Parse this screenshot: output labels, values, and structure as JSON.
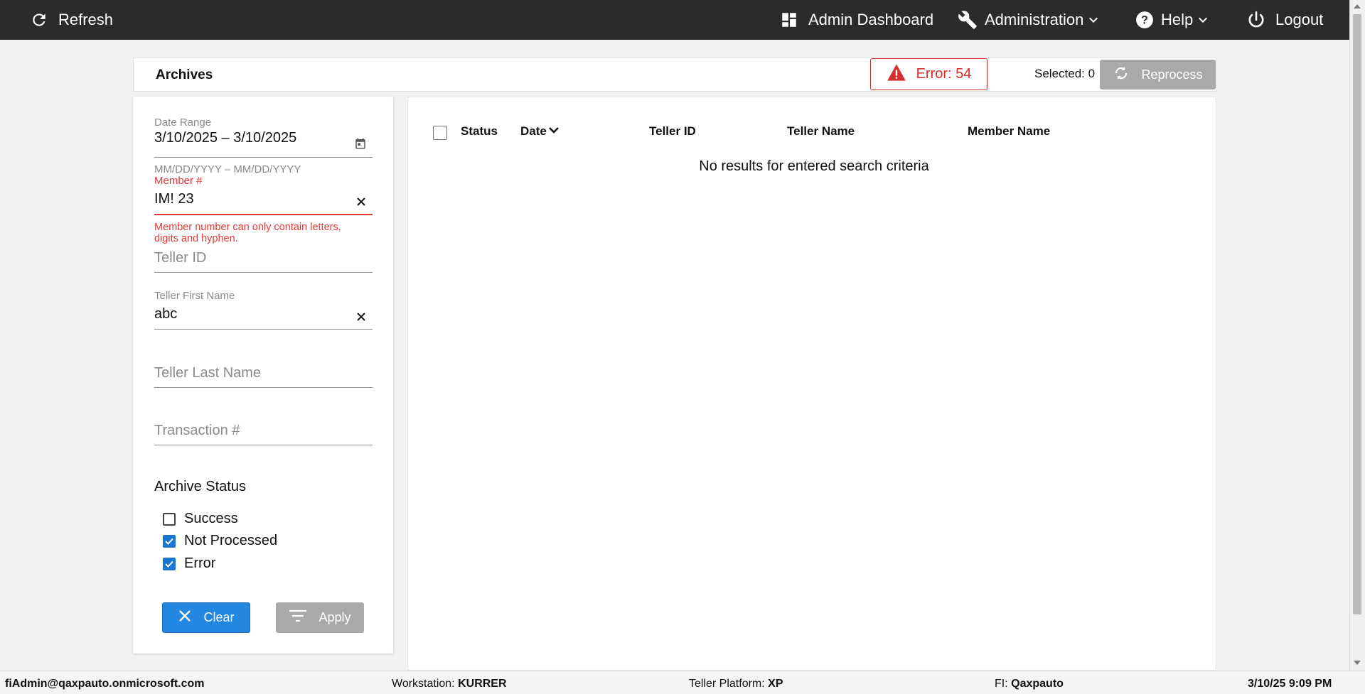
{
  "topbar": {
    "refresh_label": "Refresh",
    "admin_dashboard_label": "Admin Dashboard",
    "administration_label": "Administration",
    "help_label": "Help",
    "logout_label": "Logout"
  },
  "header": {
    "title": "Archives",
    "error_badge": "Error: 54",
    "selected_label": "Selected: 0",
    "reprocess_label": "Reprocess"
  },
  "filters": {
    "date_range": {
      "label": "Date Range",
      "value": "3/10/2025 – 3/10/2025",
      "hint": "MM/DD/YYYY – MM/DD/YYYY"
    },
    "member": {
      "label": "Member #",
      "value": "IM! 23",
      "error": "Member number can only contain letters, digits and hyphen."
    },
    "teller_id": {
      "placeholder": "Teller ID"
    },
    "teller_first_name": {
      "label": "Teller First Name",
      "value": "abc"
    },
    "teller_last_name": {
      "placeholder": "Teller Last Name"
    },
    "transaction": {
      "placeholder": "Transaction #"
    },
    "archive_status": {
      "title": "Archive Status",
      "options": [
        {
          "label": "Success",
          "checked": false
        },
        {
          "label": "Not Processed",
          "checked": true
        },
        {
          "label": "Error",
          "checked": true
        }
      ]
    },
    "clear_label": "Clear",
    "apply_label": "Apply"
  },
  "results": {
    "columns": [
      "Status",
      "Date",
      "Teller ID",
      "Teller Name",
      "Member Name"
    ],
    "empty_message": "No results for entered search criteria"
  },
  "footer": {
    "user": "fiAdmin@qaxpauto.onmicrosoft.com",
    "workstation_label": "Workstation:",
    "workstation_value": "KURRER",
    "platform_label": "Teller Platform:",
    "platform_value": "XP",
    "fi_label": "FI:",
    "fi_value": "Qaxpauto",
    "datetime": "3/10/25 9:09 PM"
  },
  "colors": {
    "topbar_bg": "#2b2b2b",
    "error_red": "#d32f2f",
    "primary_blue": "#2386e0",
    "disabled_gray": "#a9a9a9",
    "checkbox_blue": "#1976d2"
  }
}
